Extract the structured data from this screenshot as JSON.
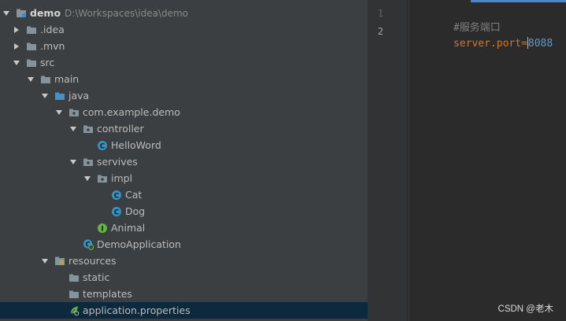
{
  "tree": {
    "root": {
      "label": "demo",
      "path": "D:\\Workspaces\\idea\\demo"
    },
    "items": [
      {
        "label": ".idea"
      },
      {
        "label": ".mvn"
      },
      {
        "label": "src"
      },
      {
        "label": "main"
      },
      {
        "label": "java"
      },
      {
        "label": "com.example.demo"
      },
      {
        "label": "controller"
      },
      {
        "label": "HelloWord",
        "badge": "C"
      },
      {
        "label": "servives"
      },
      {
        "label": "impl"
      },
      {
        "label": "Cat",
        "badge": "C"
      },
      {
        "label": "Dog",
        "badge": "C"
      },
      {
        "label": "Animal",
        "badge": "I"
      },
      {
        "label": "DemoApplication"
      },
      {
        "label": "resources"
      },
      {
        "label": "static"
      },
      {
        "label": "templates"
      },
      {
        "label": "application.properties"
      }
    ],
    "selected": "application.properties"
  },
  "editor": {
    "lines": [
      {
        "number": "1",
        "comment": "#服务端口"
      },
      {
        "number": "2",
        "key": "server.port",
        "eq": "=",
        "value": "8088"
      }
    ]
  },
  "colors": {
    "panel_bg": "#3c3f41",
    "editor_bg": "#2b2b2b",
    "selection": "#0d293e",
    "folder": "#87939a",
    "source_folder": "#4a8fc2",
    "class_badge": "#3592c4",
    "interface_badge": "#62b543",
    "tab_accent": "#4a88c7"
  },
  "icons": {
    "expanded": "triangle-down-icon",
    "collapsed": "triangle-right-icon",
    "folder": "folder-icon",
    "package": "package-icon",
    "class": "class-icon",
    "interface": "interface-icon",
    "spring_boot": "spring-boot-icon",
    "resources": "resources-folder-icon",
    "properties": "properties-file-icon"
  },
  "watermark": "CSDN @老木"
}
